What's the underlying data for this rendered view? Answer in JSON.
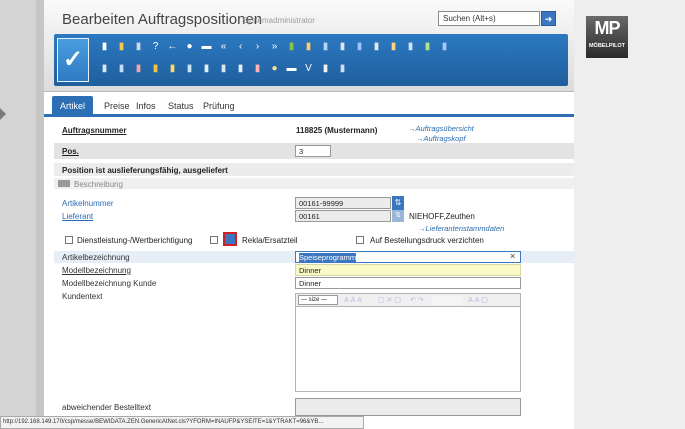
{
  "header": {
    "title": "Bearbeiten Auftragspositionen",
    "user": "Systemadministrator",
    "search_placeholder": "Suchen (Alt+s)"
  },
  "toolbar": {
    "save_glyph": "✓",
    "row1_icons": [
      {
        "name": "page-icon",
        "glyph": "▮",
        "color": "#ffffff"
      },
      {
        "name": "document-icon",
        "glyph": "▮",
        "color": "#f2c94c"
      },
      {
        "name": "trash-icon",
        "glyph": "▮",
        "color": "#d0d8e0"
      },
      {
        "name": "help-icon",
        "glyph": "?",
        "color": "#ffffff"
      },
      {
        "name": "back-arrow-icon",
        "glyph": "←",
        "color": "#ffffff"
      },
      {
        "name": "search-icon",
        "glyph": "●",
        "color": "#ffffff"
      },
      {
        "name": "print-icon",
        "glyph": "▬",
        "color": "#ffffff"
      },
      {
        "name": "first-icon",
        "glyph": "«",
        "color": "#ffffff"
      },
      {
        "name": "prev-icon",
        "glyph": "‹",
        "color": "#ffffff"
      },
      {
        "name": "next-icon",
        "glyph": "›",
        "color": "#ffffff"
      },
      {
        "name": "last-icon",
        "glyph": "»",
        "color": "#ffffff"
      },
      {
        "name": "users-icon",
        "glyph": "▮",
        "color": "#8bc34a"
      },
      {
        "name": "tag-icon",
        "glyph": "▮",
        "color": "#ffcc66"
      },
      {
        "name": "truck-icon",
        "glyph": "▮",
        "color": "#b3d4f5"
      },
      {
        "name": "list-icon",
        "glyph": "▮",
        "color": "#dfe6ee"
      },
      {
        "name": "truck-plus-icon",
        "glyph": "▮",
        "color": "#a0c4ff"
      },
      {
        "name": "stack-icon",
        "glyph": "▮",
        "color": "#e8e8e8"
      },
      {
        "name": "chart-icon",
        "glyph": "▮",
        "color": "#ffd27f"
      },
      {
        "name": "grid-icon",
        "glyph": "▮",
        "color": "#cfe3ff"
      },
      {
        "name": "doc-green-icon",
        "glyph": "▮",
        "color": "#b6e388"
      },
      {
        "name": "doc-blue-icon",
        "glyph": "▮",
        "color": "#a6c8ff"
      }
    ],
    "row2_icons": [
      {
        "name": "report-icon",
        "glyph": "▮",
        "color": "#dbe7f6"
      },
      {
        "name": "arrow-doc-icon",
        "glyph": "▮",
        "color": "#c8ddf5"
      },
      {
        "name": "doc-red-icon",
        "glyph": "▮",
        "color": "#f7a6a6"
      },
      {
        "name": "people-icon",
        "glyph": "▮",
        "color": "#f4c542"
      },
      {
        "name": "folder-icon",
        "glyph": "▮",
        "color": "#ffd966"
      },
      {
        "name": "doc-check-icon",
        "glyph": "▮",
        "color": "#cfe2f3"
      },
      {
        "name": "doc-arrow-icon",
        "glyph": "▮",
        "color": "#e4eef9"
      },
      {
        "name": "doc-print-icon",
        "glyph": "▮",
        "color": "#d9e6f4"
      },
      {
        "name": "doc-edit-icon",
        "glyph": "▮",
        "color": "#e7eef7"
      },
      {
        "name": "flag-icon",
        "glyph": "▮",
        "color": "#ffb3b3"
      },
      {
        "name": "euro-icon",
        "glyph": "●",
        "color": "#ffe08a"
      },
      {
        "name": "printer-icon",
        "glyph": "▬",
        "color": "#ffffff"
      },
      {
        "name": "filter-icon",
        "glyph": "V",
        "color": "#ffffff"
      },
      {
        "name": "doc-plain-icon",
        "glyph": "▮",
        "color": "#f1f1f1"
      },
      {
        "name": "table-icon",
        "glyph": "▮",
        "color": "#cce0f5"
      }
    ]
  },
  "tabs": [
    "Artikel",
    "Preise",
    "Infos",
    "Status",
    "Prüfung"
  ],
  "form": {
    "auftragsnummer_label": "Auftragsnummer",
    "auftragsnummer_value": "118825 (Mustermann)",
    "link_uebersicht": "→Auftragsübersicht",
    "link_kopf": "→Auftragskopf",
    "pos_label": "Pos.",
    "pos_value": "3",
    "status_text": "Position ist auslieferungsfähig, ausgeliefert",
    "beschreibung_label": "Beschreibung",
    "artikelnummer_label": "Artikelnummer",
    "artikelnummer_value": "00161-99999",
    "lieferant_label": "Lieferant",
    "lieferant_value": "00161",
    "lieferant_name": "NIEHOFF,Zeuthen",
    "link_lieferantenstammdaten": "→Lieferantenstammdaten",
    "cb_dienstleistung": "Dienstleistung-/Wertberichtigung",
    "cb_rekla": "Rekla/Ersatzteil",
    "cb_bestelldruck": "Auf Bestellungsdruck verzichten",
    "artikelbezeichnung_label": "Artikelbezeichnung",
    "artikelbezeichnung_value": "Speiseprogramm",
    "modellbezeichnung_label": "Modellbezeichnung",
    "modellbezeichnung_value": "Dinner",
    "modellbezeichnung_kunde_label": "Modellbezeichnung Kunde",
    "modellbezeichnung_kunde_value": "Dinner",
    "kundentext_label": "Kundentext",
    "editor_size": "— size —",
    "abweichender_label": "abweichender Bestelltext",
    "clear_glyph": "×"
  },
  "logo": {
    "text": "MP",
    "sub": "MÖBELPILOT"
  },
  "statusbar": "http://192.168.149.170/csp/messe/BEWIDATA.ZEN.GenericAtNet.cls?YFORM=INAUFP&YSEITE=1&YTRAKT=96&YB..."
}
